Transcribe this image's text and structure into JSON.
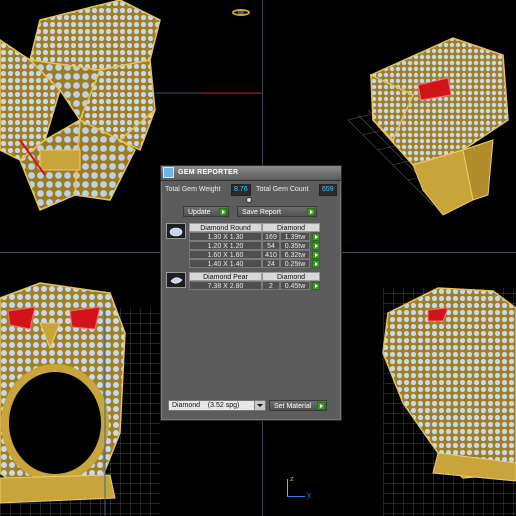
{
  "app": {
    "panel_title": "GEM REPORTER"
  },
  "stats": {
    "total_weight_label": "Total Gem Weight",
    "total_weight_value": "8.76",
    "total_count_label": "Total Gem Count",
    "total_count_value": "659"
  },
  "buttons": {
    "update": "Update",
    "save_report": "Save Report",
    "set_material": "Set Material"
  },
  "groups": [
    {
      "type_header": "Diamond Round",
      "material_header": "Diamond",
      "rows": [
        {
          "size": "1.30 X 1.30",
          "count": "169",
          "tw": "1.39tw"
        },
        {
          "size": "1.20 X 1.20",
          "count": "54",
          "tw": "0.35tw"
        },
        {
          "size": "1.60 X 1.60",
          "count": "410",
          "tw": "6.32tw"
        },
        {
          "size": "1.40 X 1.40",
          "count": "24",
          "tw": "0.25tw"
        }
      ]
    },
    {
      "type_header": "Diamond Pear",
      "material_header": "Diamond",
      "rows": [
        {
          "size": "7.38 X 2.80",
          "count": "2",
          "tw": "0.45tw"
        }
      ]
    }
  ],
  "material_select": {
    "value": "Diamond    (3.52 spg)"
  },
  "axis": {
    "z": "z",
    "y": "y"
  },
  "colors": {
    "gold": "#c9a43a",
    "gold_dark": "#8a6a18",
    "diamond": "#c8d8ea",
    "ruby": "#d0141a",
    "grid": "#8f8f8f",
    "panel_bg": "#5c5c5c",
    "value_text": "#4ac3ff",
    "go_green": "#3f9a27"
  }
}
